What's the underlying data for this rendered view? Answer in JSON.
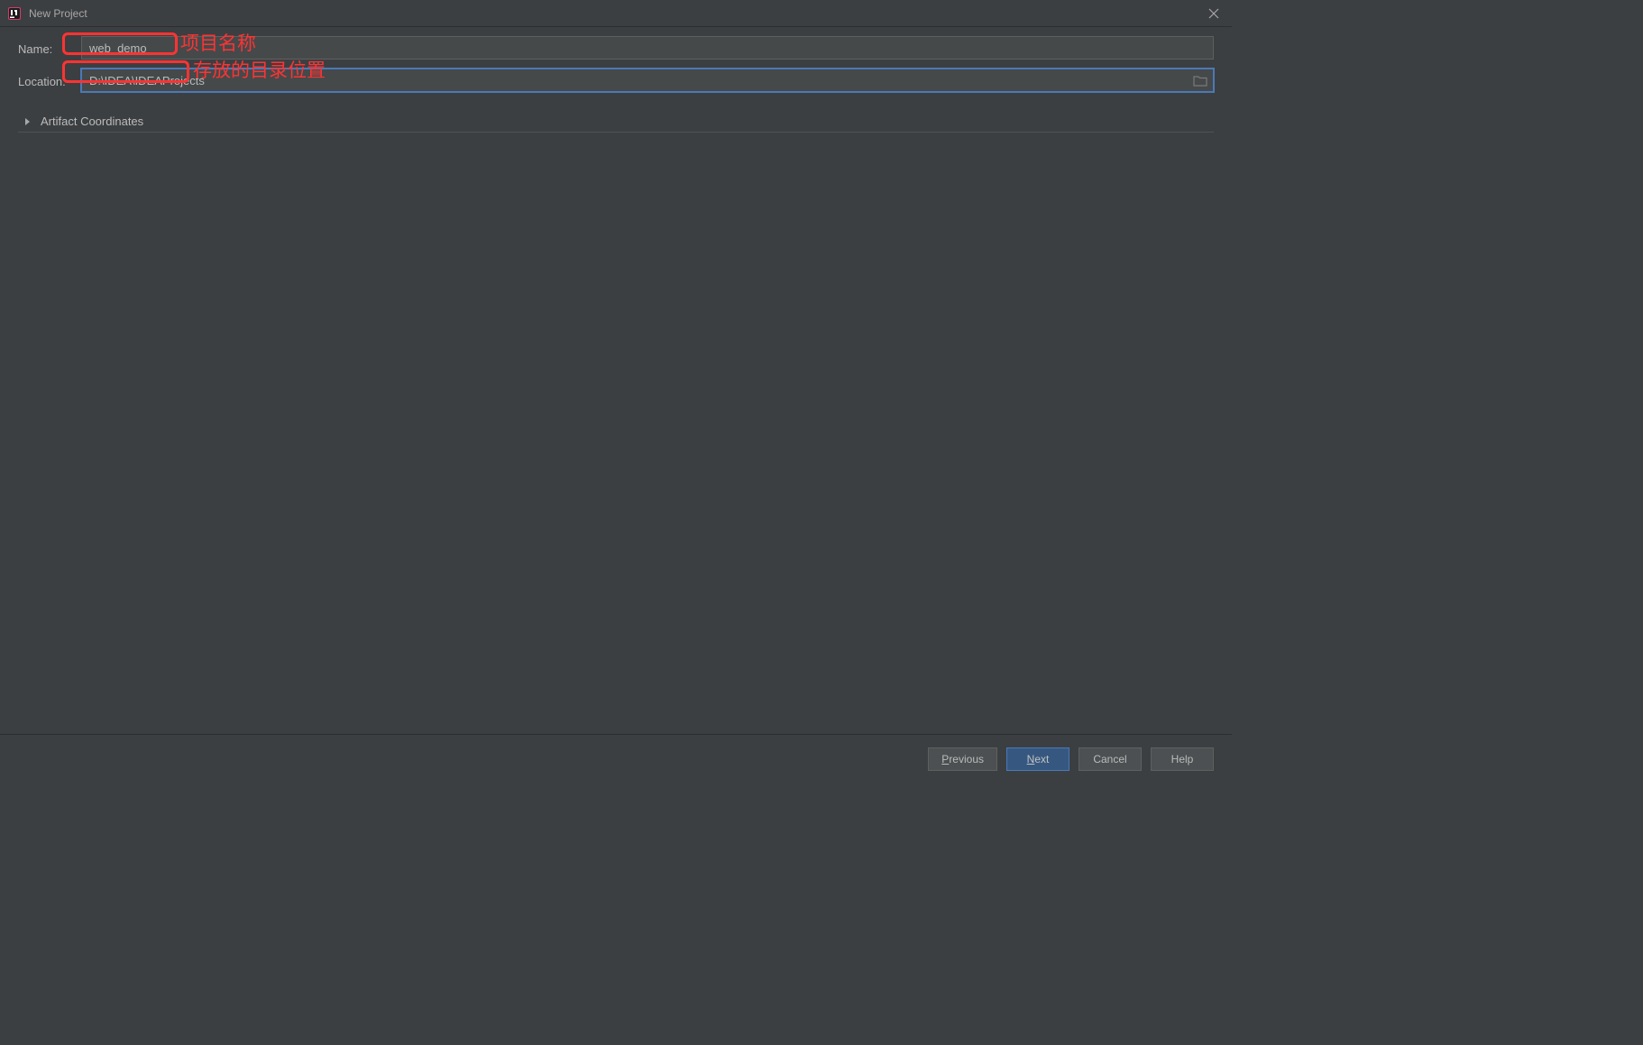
{
  "window": {
    "title": "New Project"
  },
  "form": {
    "name_label": "Name:",
    "name_value": "web_demo",
    "location_label": "Location:",
    "location_value": "D:\\IDEA\\IDEAProjects"
  },
  "annotations": {
    "name_note": "项目名称",
    "location_note": "存放的目录位置"
  },
  "expander": {
    "artifact_label": "Artifact Coordinates"
  },
  "footer": {
    "previous": "Previous",
    "next": "Next",
    "cancel": "Cancel",
    "help": "Help"
  },
  "colors": {
    "accent": "#365880",
    "focus_border": "#4a79b8",
    "annotation_red": "#ff3333"
  }
}
